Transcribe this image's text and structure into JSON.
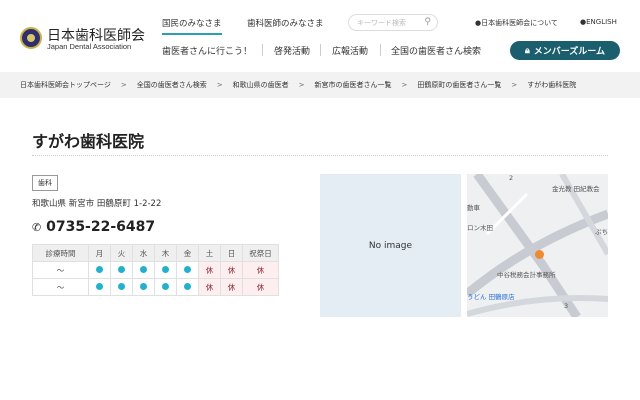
{
  "header": {
    "logo_ja": "日本歯科医師会",
    "logo_en": "Japan Dental Association",
    "tabs": [
      {
        "label": "国民のみなさま"
      },
      {
        "label": "歯科医師のみなさま"
      }
    ],
    "search_placeholder": "キーワード検索",
    "util_links": [
      {
        "label": "日本歯科医師会について"
      },
      {
        "label": "ENGLISH"
      }
    ],
    "nav": [
      {
        "label": "歯医者さんに行こう！"
      },
      {
        "label": "啓発活動"
      },
      {
        "label": "広報活動"
      },
      {
        "label": "全国の歯医者さん検索"
      }
    ],
    "member_button": "メンバーズルーム"
  },
  "breadcrumb": [
    {
      "label": "日本歯科医師会トップページ"
    },
    {
      "label": "全国の歯医者さん検索"
    },
    {
      "label": "和歌山県の歯医者"
    },
    {
      "label": "新宮市の歯医者さん一覧"
    },
    {
      "label": "田鶴原町の歯医者さん一覧"
    },
    {
      "label": "すがわ歯科医院"
    }
  ],
  "clinic": {
    "name": "すがわ歯科医院",
    "tag": "歯科",
    "address": "和歌山県 新宮市 田鶴原町 1-2-22",
    "phone": "0735-22-6487",
    "hours": {
      "headers": [
        "診療時間",
        "月",
        "火",
        "水",
        "木",
        "金",
        "土",
        "日",
        "祝祭日"
      ],
      "rows": [
        {
          "time": "〜",
          "days": [
            "open",
            "open",
            "open",
            "open",
            "open",
            "休",
            "休",
            "休"
          ]
        },
        {
          "time": "〜",
          "days": [
            "open",
            "open",
            "open",
            "open",
            "open",
            "休",
            "休",
            "休"
          ]
        }
      ]
    }
  },
  "no_image": "No image",
  "map": {
    "labels": [
      "2",
      "金光教 田紀教会",
      "動車",
      "ロン木田",
      "ぷち",
      "中谷税務会計事務所",
      "うどん 田鶴原店",
      "3"
    ]
  },
  "colors": {
    "accent": "#2a9fb5",
    "member": "#1b5e6e",
    "open_dot": "#24b0cc",
    "closed": "#8a1c2c"
  }
}
